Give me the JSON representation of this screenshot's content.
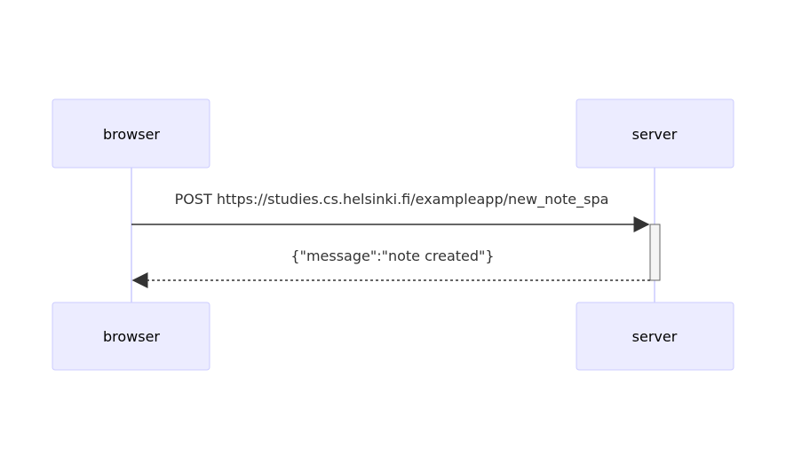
{
  "participants": {
    "browser": "browser",
    "server": "server"
  },
  "messages": [
    {
      "from": "browser",
      "to": "server",
      "text": "POST https://studies.cs.helsinki.fi/exampleapp/new_note_spa",
      "style": "solid"
    },
    {
      "from": "server",
      "to": "browser",
      "text": "{\"message\":\"note created\"}",
      "style": "dashed"
    }
  ],
  "colors": {
    "actor_fill": "#ECECFF",
    "actor_border": "#CCCCFF",
    "line": "#333333",
    "activation_fill": "#F4F4F4"
  }
}
